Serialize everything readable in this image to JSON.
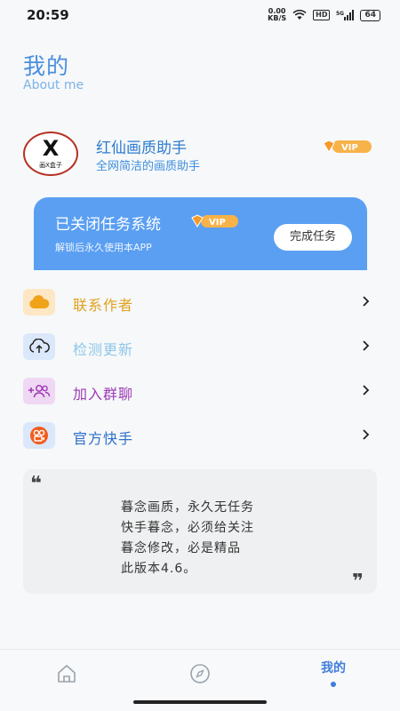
{
  "status_bar": {
    "time": "20:59",
    "net_speed_value": "0.00",
    "net_speed_unit": "KB/S",
    "hd": "HD",
    "signal": "5G",
    "battery": "64"
  },
  "header": {
    "title": "我的",
    "subtitle": "About me"
  },
  "profile": {
    "avatar_letter": "X",
    "avatar_caption": "画X盒子",
    "name": "红仙画质助手",
    "description": "全网简洁的画质助手",
    "vip_badge": "VIP"
  },
  "banner": {
    "title": "已关闭任务系统",
    "vip_badge": "VIP",
    "subtitle": "解锁后永久使用本APP",
    "button_label": "完成任务"
  },
  "menu": {
    "items": [
      {
        "label": "联系作者",
        "icon": "cloud-icon",
        "color": "#e2a11f",
        "bg": "#fde7c4"
      },
      {
        "label": "检测更新",
        "icon": "cloud-upload-icon",
        "color": "#8fc6ea",
        "bg": "#dbe8fb"
      },
      {
        "label": "加入群聊",
        "icon": "add-group-icon",
        "color": "#9c3cb6",
        "bg": "#efd8f3"
      },
      {
        "label": "官方快手",
        "icon": "kuaishou-icon",
        "color": "#2f6fcc",
        "bg": "#dbe7fb"
      }
    ]
  },
  "quote": {
    "open_mark": "❝",
    "close_mark": "❞",
    "lines": [
      "暮念画质，永久无任务",
      "快手暮念，必须给关注",
      "暮念修改，必是精品",
      "此版本4.6。"
    ]
  },
  "tabbar": {
    "tabs": [
      {
        "icon": "home-icon"
      },
      {
        "icon": "compass-icon"
      },
      {
        "label": "我的"
      }
    ]
  },
  "colors": {
    "accent": "#4a8ee0",
    "banner": "#5a9ff2",
    "tab_active": "#3f7ddc"
  }
}
